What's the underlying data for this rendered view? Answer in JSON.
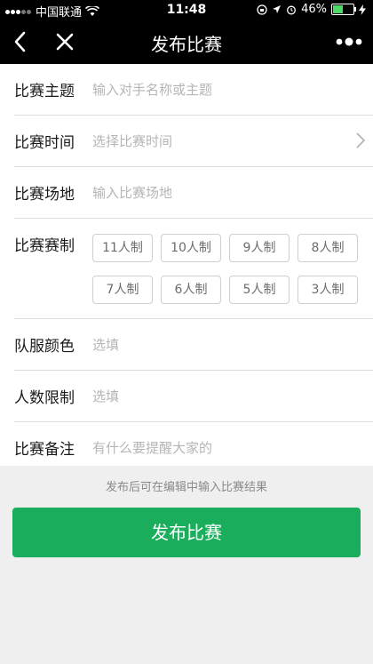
{
  "status_bar": {
    "carrier": "中国联通",
    "time": "11:48",
    "battery": "46%",
    "battery_level": 0.46
  },
  "nav": {
    "title": "发布比赛",
    "icons": [
      "chevron-left-icon",
      "close-icon",
      "more-icon"
    ]
  },
  "form": {
    "rows": [
      {
        "label": "比赛主题",
        "placeholder": "输入对手名称或主题"
      },
      {
        "label": "比赛时间",
        "placeholder": "选择比赛时间"
      },
      {
        "label": "比赛场地",
        "placeholder": "输入比赛场地"
      },
      {
        "label": "比赛赛制",
        "options": [
          "11人制",
          "10人制",
          "9人制",
          "8人制",
          "7人制",
          "6人制",
          "5人制",
          "3人制"
        ]
      },
      {
        "label": "队服颜色",
        "placeholder": "选填"
      },
      {
        "label": "人数限制",
        "placeholder": "选填"
      },
      {
        "label": "比赛备注",
        "placeholder": "有什么要提醒大家的"
      }
    ]
  },
  "footer": {
    "hint": "发布后可在编辑中输入比赛结果",
    "submit_label": "发布比赛"
  },
  "colors": {
    "topbar": "#000000",
    "accent": "#1aad5b",
    "page_bg": "#efefef"
  }
}
